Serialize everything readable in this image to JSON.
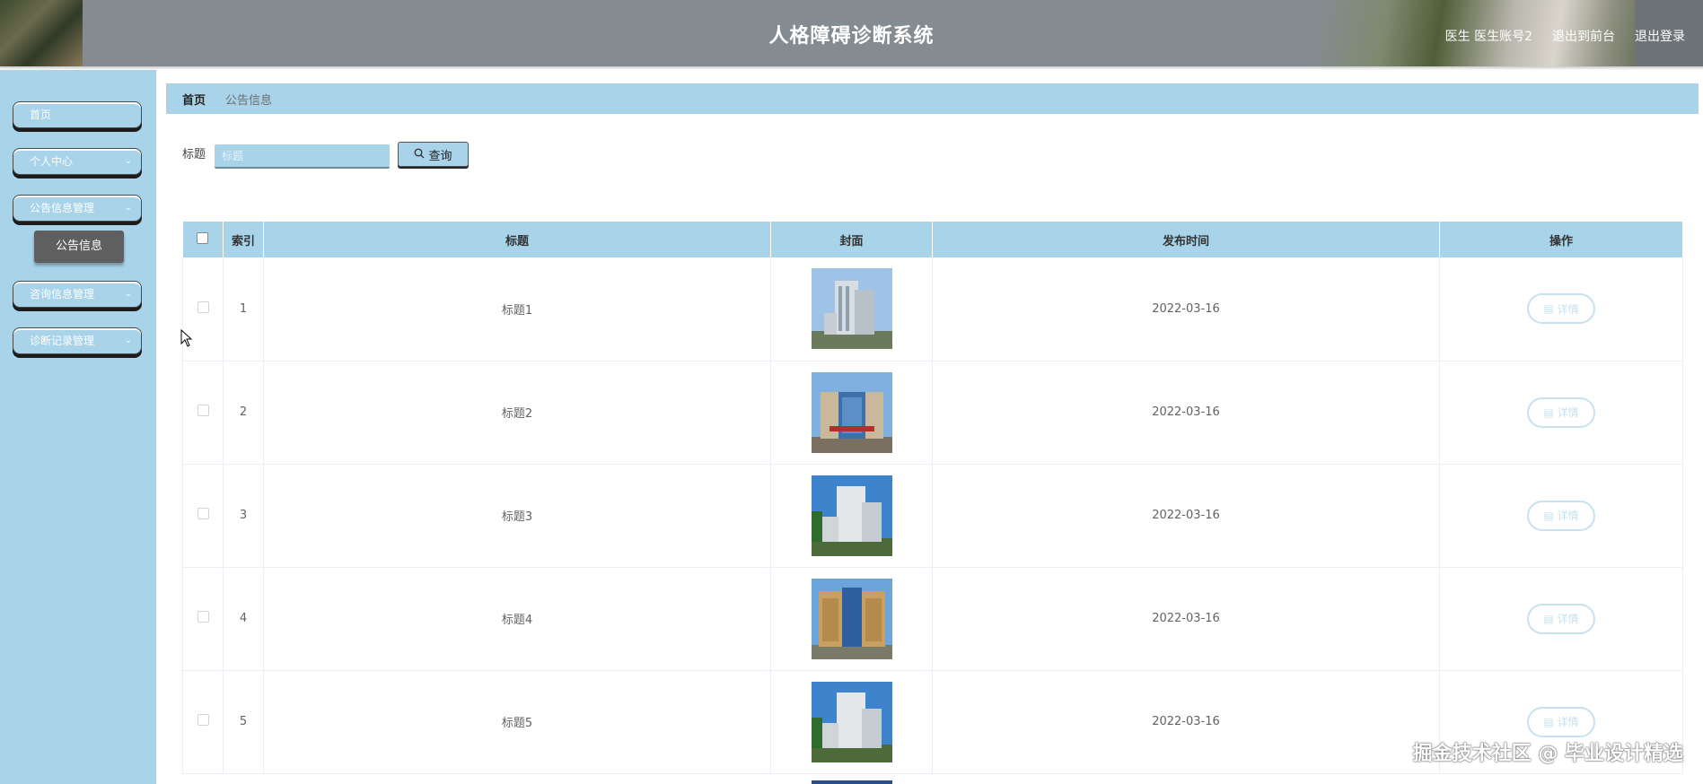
{
  "header": {
    "title": "人格障碍诊断系统",
    "user_label": "医生 医生账号2",
    "back_front_label": "退出到前台",
    "logout_label": "退出登录"
  },
  "sidebar": {
    "items": [
      {
        "label": "首页",
        "has_chevron": false
      },
      {
        "label": "个人中心",
        "has_chevron": true
      },
      {
        "label": "公告信息管理",
        "has_chevron": true
      },
      {
        "label": "咨询信息管理",
        "has_chevron": true
      },
      {
        "label": "诊断记录管理",
        "has_chevron": true
      }
    ],
    "sub_item": {
      "label": "公告信息"
    }
  },
  "breadcrumb": {
    "home": "首页",
    "current": "公告信息"
  },
  "search": {
    "label": "标题",
    "placeholder": "标题",
    "button_label": "查询",
    "button_icon": "search-icon"
  },
  "table": {
    "headers": {
      "index": "索引",
      "title": "标题",
      "cover": "封面",
      "time": "发布时间",
      "action": "操作"
    },
    "rows": [
      {
        "index": "1",
        "title": "标题1",
        "time": "2022-03-16",
        "action": "详情"
      },
      {
        "index": "2",
        "title": "标题2",
        "time": "2022-03-16",
        "action": "详情"
      },
      {
        "index": "3",
        "title": "标题3",
        "time": "2022-03-16",
        "action": "详情"
      },
      {
        "index": "4",
        "title": "标题4",
        "time": "2022-03-16",
        "action": "详情"
      },
      {
        "index": "5",
        "title": "标题5",
        "time": "2022-03-16",
        "action": "详情"
      }
    ]
  },
  "watermark": "掘金技术社区 @ 毕业设计精选",
  "colors": {
    "accent": "#a8d3e8",
    "header": "#848c91",
    "active_sub": "#5f5f5f"
  }
}
